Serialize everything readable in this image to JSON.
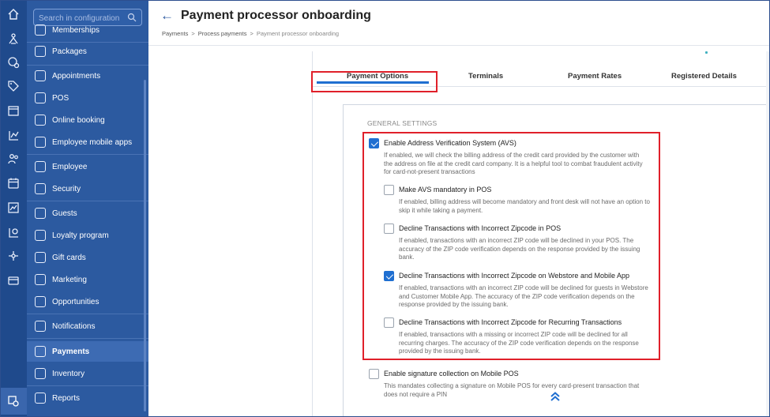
{
  "search": {
    "placeholder": "Search in configuration"
  },
  "rail": {
    "icons": [
      "home-icon",
      "hierarchy-icon",
      "settings-icon",
      "tag-icon",
      "box-icon",
      "user-icon",
      "chart-icon",
      "team-icon",
      "calendar-icon",
      "report-icon",
      "analytics-icon",
      "network-icon",
      "billing-icon",
      "config-icon"
    ]
  },
  "sidebar": {
    "items": [
      {
        "label": "Memberships",
        "icon": "membership-icon"
      },
      {
        "label": "Packages",
        "icon": "package-icon"
      },
      {
        "label": "Appointments",
        "icon": "calendar-icon"
      },
      {
        "label": "POS",
        "icon": "pos-icon"
      },
      {
        "label": "Online booking",
        "icon": "monitor-icon"
      },
      {
        "label": "Employee mobile apps",
        "icon": "mobile-icon"
      },
      {
        "label": "Employee",
        "icon": "person-icon"
      },
      {
        "label": "Security",
        "icon": "shield-icon"
      },
      {
        "label": "Guests",
        "icon": "guests-icon"
      },
      {
        "label": "Loyalty program",
        "icon": "loyalty-icon"
      },
      {
        "label": "Gift cards",
        "icon": "gift-card-icon"
      },
      {
        "label": "Marketing",
        "icon": "marketing-icon"
      },
      {
        "label": "Opportunities",
        "icon": "opportunities-icon"
      },
      {
        "label": "Notifications",
        "icon": "bell-icon"
      },
      {
        "label": "Payments",
        "icon": "payments-icon"
      },
      {
        "label": "Inventory",
        "icon": "inventory-icon"
      },
      {
        "label": "Reports",
        "icon": "reports-icon"
      }
    ],
    "active": "Payments"
  },
  "header": {
    "title": "Payment processor onboarding",
    "breadcrumb": [
      "Payments",
      "Process payments",
      "Payment processor onboarding"
    ]
  },
  "tabs": [
    {
      "label": "Payment Options",
      "active": true
    },
    {
      "label": "Terminals",
      "active": false
    },
    {
      "label": "Payment Rates",
      "active": false
    },
    {
      "label": "Registered Details",
      "active": false
    }
  ],
  "settings": {
    "section_title": "GENERAL SETTINGS",
    "avs": {
      "label": "Enable Address Verification System (AVS)",
      "checked": true,
      "desc": "If enabled, we will check the billing address of the credit card provided by the customer with the address on file at the credit card company. It is a helpful tool to combat fraudulent activity for card-not-present transactions"
    },
    "sub_options": [
      {
        "label": "Make AVS mandatory in POS",
        "checked": false,
        "desc": "If enabled, billing address will become mandatory and front desk will not have an option to skip it while taking a payment."
      },
      {
        "label": "Decline Transactions with Incorrect Zipcode in POS",
        "checked": false,
        "desc": "If enabled, transactions with an incorrect ZIP code will be declined in your POS. The accuracy of the ZIP code verification depends on the response provided by the issuing bank."
      },
      {
        "label": "Decline Transactions with Incorrect Zipcode on Webstore and Mobile App",
        "checked": true,
        "desc": "If enabled, transactions with an incorrect ZIP code will be declined for guests in Webstore and Customer Mobile App. The accuracy of the ZIP code verification depends on the response provided by the issuing bank."
      },
      {
        "label": "Decline Transactions with Incorrect Zipcode for Recurring Transactions",
        "checked": false,
        "desc": "If enabled, transactions with a missing or incorrect ZIP code will be declined for all recurring charges. The accuracy of the ZIP code verification depends on the response provided by the issuing bank."
      }
    ],
    "signature": {
      "label": "Enable signature collection on Mobile POS",
      "checked": false,
      "desc": "This mandates collecting a signature on Mobile POS for every card-present transaction that does not require a PIN"
    }
  },
  "colors": {
    "primary": "#1f6fd1",
    "nav_bg": "#2c5aa0",
    "rail_bg": "#1f4a8c",
    "highlight": "#e0202a"
  }
}
